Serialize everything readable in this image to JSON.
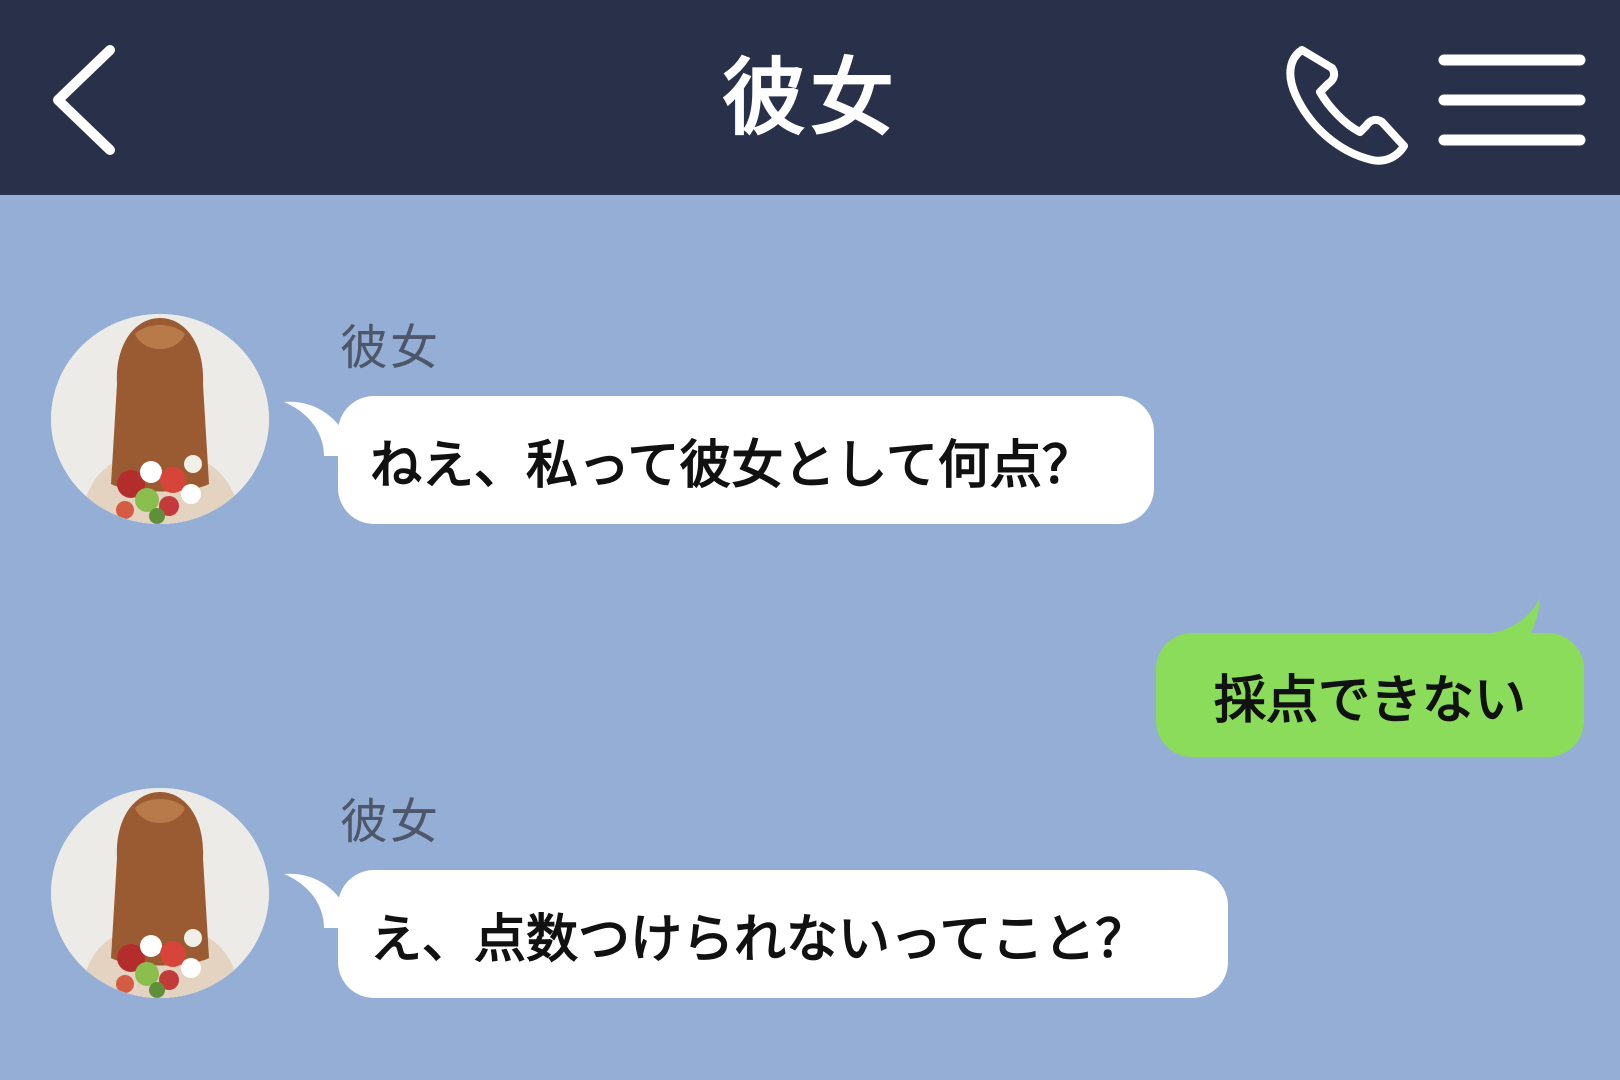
{
  "header": {
    "title": "彼女",
    "back_icon": "chevron-left-icon",
    "call_icon": "phone-icon",
    "menu_icon": "hamburger-menu-icon",
    "background": "#283149"
  },
  "chat": {
    "background": "#95aed6",
    "messages": [
      {
        "side": "left",
        "sender": "彼女",
        "text": "ねえ、私って彼女として何点？"
      },
      {
        "side": "right",
        "text": "採点できない"
      },
      {
        "side": "left",
        "sender": "彼女",
        "text": "え、点数つけられないってこと？"
      }
    ]
  },
  "colors": {
    "incoming_bubble": "#ffffff",
    "outgoing_bubble": "#8cdc5c",
    "sender_name": "#4d5769"
  }
}
